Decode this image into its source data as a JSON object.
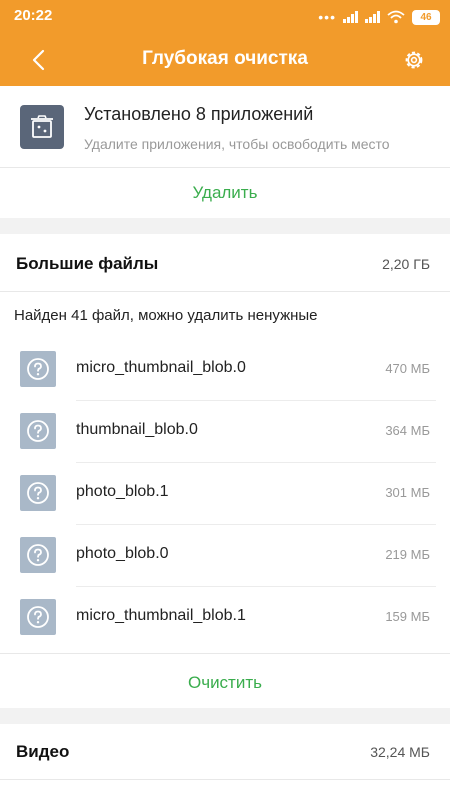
{
  "status_bar": {
    "time": "20:22",
    "battery": "46"
  },
  "header": {
    "title": "Глубокая очистка"
  },
  "apps_section": {
    "title": "Установлено 8 приложений",
    "subtitle": "Удалите приложения, чтобы освободить место",
    "action_label": "Удалить"
  },
  "large_files": {
    "title": "Большие файлы",
    "total_size": "2,20 ГБ",
    "found_text": "Найден 41 файл, можно удалить ненужные",
    "files": [
      {
        "name": "micro_thumbnail_blob.0",
        "size": "470 МБ"
      },
      {
        "name": "thumbnail_blob.0",
        "size": "364 МБ"
      },
      {
        "name": "photo_blob.1",
        "size": "301 МБ"
      },
      {
        "name": "photo_blob.0",
        "size": "219 МБ"
      },
      {
        "name": "micro_thumbnail_blob.1",
        "size": "159 МБ"
      }
    ],
    "action_label": "Очистить"
  },
  "video": {
    "title": "Видео",
    "size": "32,24 МБ"
  },
  "colors": {
    "accent": "#f29b2b",
    "action": "#3aad4d",
    "file_icon": "#a9b8c8",
    "app_icon": "#5a6679"
  }
}
